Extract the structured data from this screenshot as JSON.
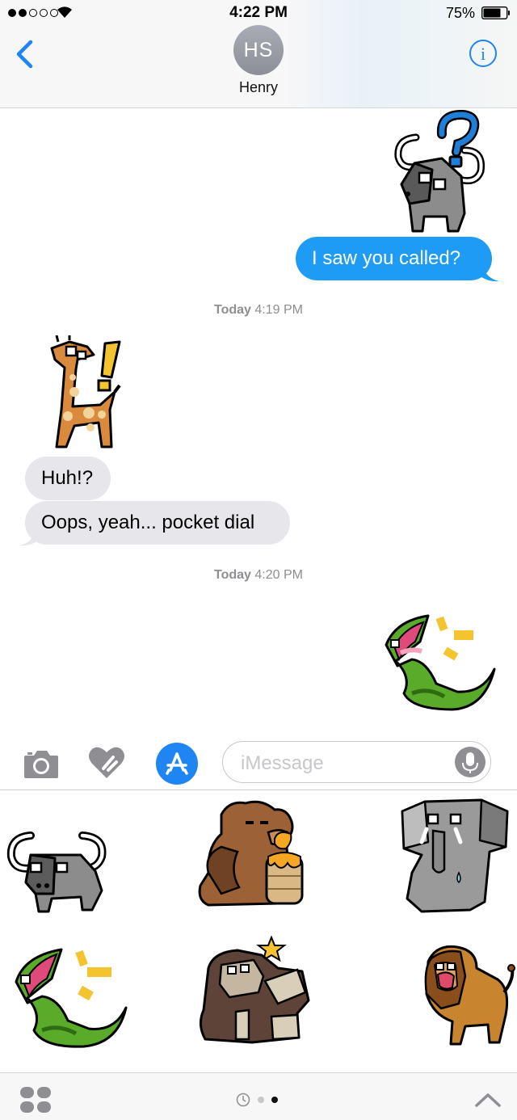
{
  "status_bar": {
    "time": "4:22 PM",
    "battery_percent": "75%",
    "signal_bars_filled": 2,
    "signal_bars_total": 5,
    "battery_level": 0.75
  },
  "header": {
    "avatar_initials": "HS",
    "contact_name": "Henry"
  },
  "messages": {
    "outgoing_1": "I saw you called?",
    "timestamp_1_day": "Today",
    "timestamp_1_time": "4:19 PM",
    "incoming_1": "Huh!?",
    "incoming_2": "Oops, yeah... pocket dial",
    "timestamp_2_day": "Today",
    "timestamp_2_time": "4:20 PM"
  },
  "input": {
    "placeholder": "iMessage"
  },
  "drawer": {
    "stickers": [
      "buffalo",
      "bear with honey pot",
      "elephant",
      "crocodile",
      "gorilla",
      "lion"
    ],
    "page_count": 2,
    "active_page": 2
  },
  "colors": {
    "outgoing_bubble": "#1e9bf5",
    "incoming_bubble": "#e6e6eb",
    "ios_blue": "#1e85f2",
    "timestamp_gray": "#8e8e93"
  },
  "icons": [
    "back-chevron-icon",
    "info-icon",
    "camera-icon",
    "digital-touch-heart-icon",
    "app-store-icon",
    "microphone-icon",
    "apps-grid-icon",
    "recents-clock-icon",
    "chevron-up-icon",
    "wifi-icon",
    "battery-icon"
  ]
}
